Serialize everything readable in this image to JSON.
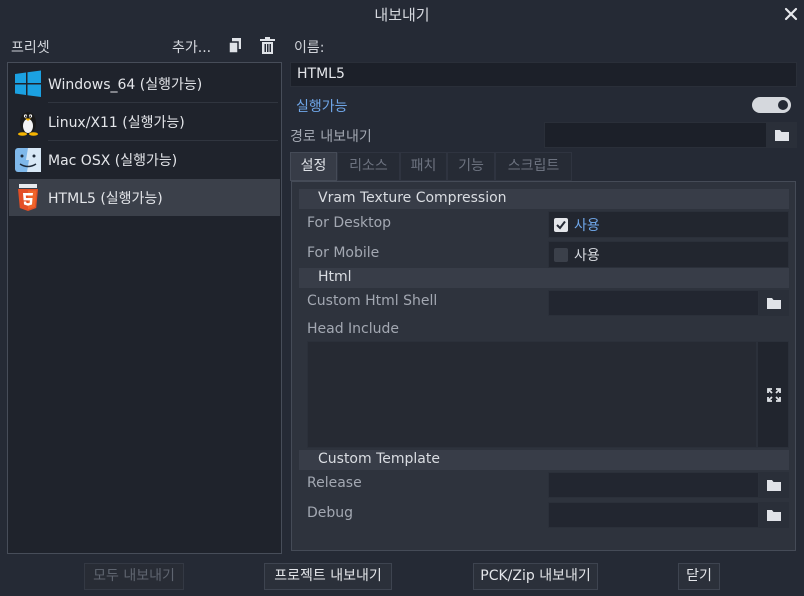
{
  "window": {
    "title": "내보내기",
    "close_icon": "close-icon"
  },
  "presets": {
    "label": "프리셋",
    "add_label": "추가...",
    "items": [
      {
        "label": "Windows_64 (실행가능)",
        "icon": "windows-icon"
      },
      {
        "label": "Linux/X11 (실행가능)",
        "icon": "linux-tux-icon"
      },
      {
        "label": "Mac OSX (실행가능)",
        "icon": "mac-finder-icon"
      },
      {
        "label": "HTML5 (실행가능)",
        "icon": "html5-icon",
        "selected": true
      }
    ]
  },
  "details": {
    "name_label": "이름:",
    "name_value": "HTML5",
    "runnable_label": "실행가능",
    "runnable_on": true,
    "export_path_label": "경로 내보내기",
    "export_path_value": ""
  },
  "tabs": [
    "설정",
    "리소스",
    "패치",
    "기능",
    "스크립트"
  ],
  "settings": {
    "vram_section": "Vram Texture Compression",
    "for_desktop_label": "For Desktop",
    "for_desktop_checked": true,
    "for_mobile_label": "For Mobile",
    "for_mobile_checked": false,
    "enable_label": "사용",
    "html_section": "Html",
    "custom_html_shell_label": "Custom Html Shell",
    "head_include_label": "Head Include",
    "custom_template_section": "Custom Template",
    "release_label": "Release",
    "debug_label": "Debug"
  },
  "footer": {
    "export_all": "모두 내보내기",
    "export_project": "프로젝트 내보내기",
    "export_pck_zip": "PCK/Zip 내보내기",
    "close": "닫기"
  },
  "colors": {
    "accent": "#6fa6e8",
    "background": "#252a35",
    "selected": "#3b404a"
  }
}
